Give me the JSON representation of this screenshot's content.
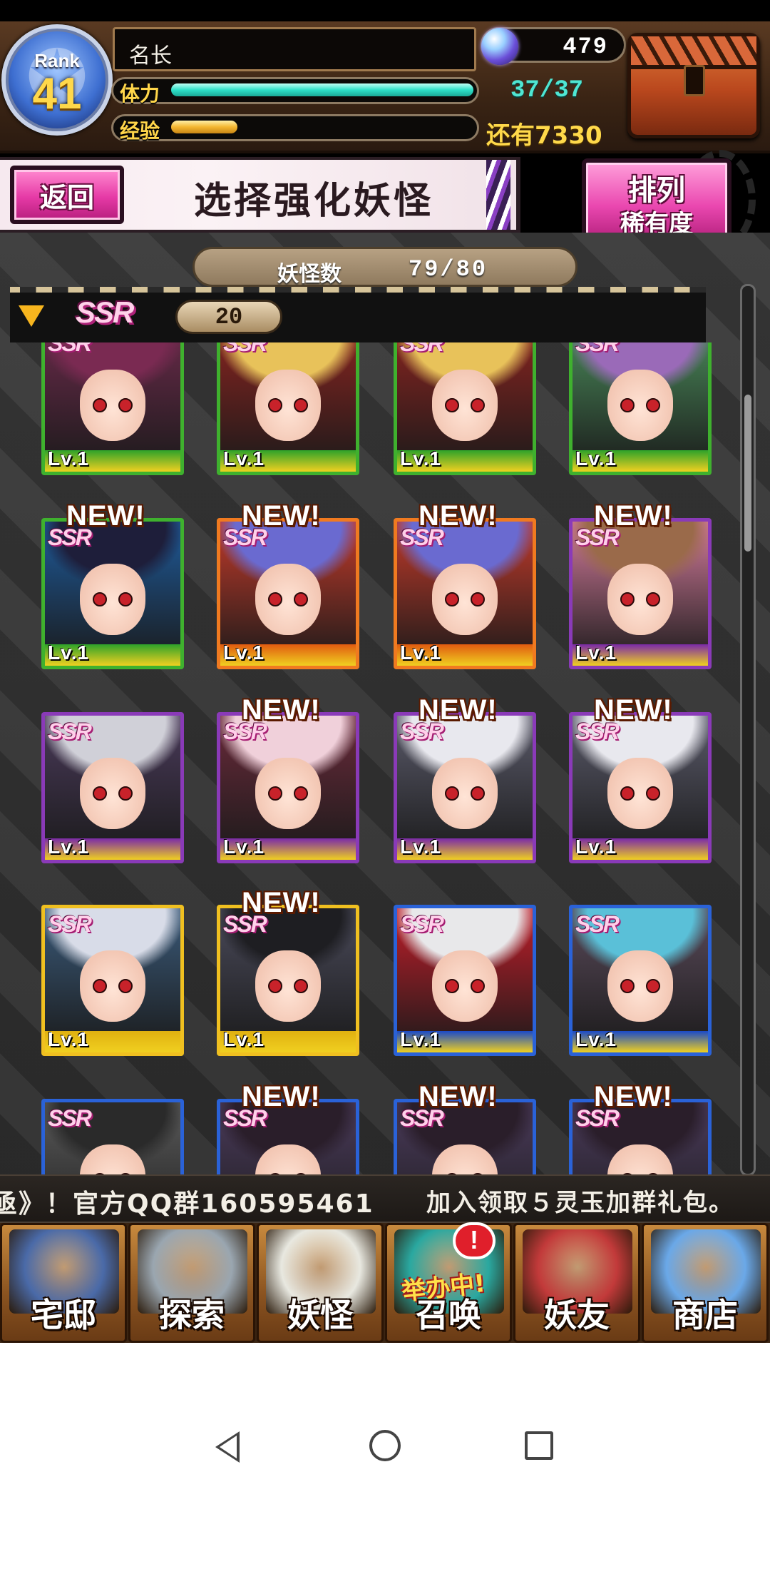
{
  "header": {
    "rank_label": "Rank",
    "rank_value": "41",
    "player_name": "名长",
    "gems": "479",
    "stamina_label": "体力",
    "stamina_value": "37/37",
    "stamina_fraction": 1.0,
    "exp_label": "经验",
    "exp_fraction": 0.22,
    "exp_remaining": "还有7330",
    "icons": [
      "rank-star-icon",
      "gem-orb-icon",
      "treasure-chest-icon"
    ]
  },
  "titlebar": {
    "back_label": "返回",
    "title": "选择强化妖怪",
    "sort_label": "排列",
    "sort_value": "稀有度"
  },
  "list": {
    "count_label": "妖怪数",
    "count_value": "79/80",
    "rarity_label": "SSR",
    "rarity_count": "20",
    "level_text": "Lv.1",
    "new_text": "NEW!",
    "ssr_text": "SSR",
    "cards": [
      {
        "frame": "#3fb12e",
        "strip": "#2ea22a",
        "portrait": "#6a2a4a",
        "hair": "#7a2a52",
        "new": false,
        "ssr": true
      },
      {
        "frame": "#3fb12e",
        "strip": "#2ea22a",
        "portrait": "#8a2420",
        "hair": "#e8c25a",
        "new": false,
        "ssr": true
      },
      {
        "frame": "#3fb12e",
        "strip": "#2ea22a",
        "portrait": "#8a2420",
        "hair": "#e8c25a",
        "new": false,
        "ssr": true
      },
      {
        "frame": "#3fb12e",
        "strip": "#2ea22a",
        "portrait": "#4a8a5a",
        "hair": "#9a6ab8",
        "new": false,
        "ssr": true
      },
      {
        "frame": "#3fb12e",
        "strip": "#2ea22a",
        "portrait": "#1e5a9a",
        "hair": "#1e1e3a",
        "new": true,
        "ssr": true
      },
      {
        "frame": "#f07a20",
        "strip": "#e05a10",
        "portrait": "#c23a2a",
        "hair": "#6a6ad0",
        "new": true,
        "ssr": true
      },
      {
        "frame": "#f07a20",
        "strip": "#e05a10",
        "portrait": "#c23a2a",
        "hair": "#6a6ad0",
        "new": true,
        "ssr": true
      },
      {
        "frame": "#8a3ab8",
        "strip": "#7a2aa8",
        "portrait": "#d27a9a",
        "hair": "#9a6a4a",
        "new": true,
        "ssr": true
      },
      {
        "frame": "#8a3ab8",
        "strip": "#7a2aa8",
        "portrait": "#4a3a5a",
        "hair": "#d0d0d8",
        "new": false,
        "ssr": true
      },
      {
        "frame": "#8a3ab8",
        "strip": "#7a2aa8",
        "portrait": "#6a2a3a",
        "hair": "#f0d0da",
        "new": true,
        "ssr": true
      },
      {
        "frame": "#8a3ab8",
        "strip": "#7a2aa8",
        "portrait": "#5a5a6a",
        "hair": "#e8e8ee",
        "new": true,
        "ssr": true
      },
      {
        "frame": "#8a3ab8",
        "strip": "#7a2aa8",
        "portrait": "#5a5a6a",
        "hair": "#e8e8ee",
        "new": true,
        "ssr": true
      },
      {
        "frame": "#f0c020",
        "strip": "#e0b010",
        "portrait": "#3a5a7a",
        "hair": "#d8dce8",
        "new": false,
        "ssr": true
      },
      {
        "frame": "#f0c020",
        "strip": "#e0b010",
        "portrait": "#4a4a5a",
        "hair": "#1e1e22",
        "new": true,
        "ssr": true
      },
      {
        "frame": "#2a62d8",
        "strip": "#1a4ac8",
        "portrait": "#c21e2a",
        "hair": "#e8e8ea",
        "new": false,
        "ssr": true
      },
      {
        "frame": "#2a62d8",
        "strip": "#1a4ac8",
        "portrait": "#5a4a5a",
        "hair": "#5ac0d8",
        "new": false,
        "ssr": true
      },
      {
        "frame": "#2a62d8",
        "strip": "#1a4ac8",
        "portrait": "#5a5a5a",
        "hair": "#2a2a2a",
        "new": false,
        "ssr": true
      },
      {
        "frame": "#2a62d8",
        "strip": "#1a4ac8",
        "portrait": "#4a3a5a",
        "hair": "#2a1e2a",
        "new": true,
        "ssr": true
      },
      {
        "frame": "#2a62d8",
        "strip": "#1a4ac8",
        "portrait": "#4a3a5a",
        "hair": "#2a1e2a",
        "new": true,
        "ssr": true
      },
      {
        "frame": "#2a62d8",
        "strip": "#1a4ac8",
        "portrait": "#4a3a5a",
        "hair": "#2a1e2a",
        "new": true,
        "ssr": true
      }
    ]
  },
  "ticker": {
    "text_left": "亟》！官方QQ群160595461",
    "text_right": "加入领取５灵玉加群礼包。"
  },
  "nav": {
    "items": [
      {
        "label": "宅邸",
        "icon": "mansion-icon",
        "art": "#4a6aa8"
      },
      {
        "label": "探索",
        "icon": "magnifier-icon",
        "art": "#9aa6b0"
      },
      {
        "label": "妖怪",
        "icon": "scroll-icon",
        "art": "#e8e8e0"
      },
      {
        "label": "召唤",
        "icon": "summon-star-icon",
        "art": "#2aa8a0",
        "event": "举办中!",
        "badge": "!"
      },
      {
        "label": "妖友",
        "icon": "fox-girl-icon",
        "art": "#c23a3a"
      },
      {
        "label": "商店",
        "icon": "crystal-orb-icon",
        "art": "#6aa8e8"
      }
    ]
  }
}
